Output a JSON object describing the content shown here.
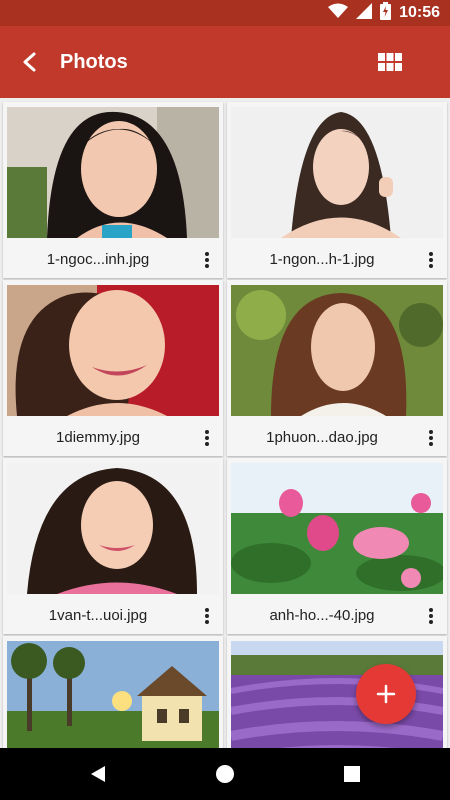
{
  "status_bar": {
    "time": "10:56",
    "icons": [
      "wifi-icon",
      "signal-icon",
      "battery-charging-icon"
    ]
  },
  "app_bar": {
    "title": "Photos",
    "back_icon": "chevron-left-icon",
    "view_icon": "grid-view-icon",
    "background": "#c0392b"
  },
  "photos": [
    {
      "file_name": "1-ngoc...inh.jpg",
      "thumbnail": "portrait"
    },
    {
      "file_name": "1-ngon...h-1.jpg",
      "thumbnail": "portrait"
    },
    {
      "file_name": "1diemmy.jpg",
      "thumbnail": "portrait"
    },
    {
      "file_name": "1phuon...dao.jpg",
      "thumbnail": "portrait"
    },
    {
      "file_name": "1van-t...uoi.jpg",
      "thumbnail": "portrait"
    },
    {
      "file_name": "anh-ho...-40.jpg",
      "thumbnail": "lotus"
    },
    {
      "file_name": "",
      "thumbnail": "house"
    },
    {
      "file_name": "",
      "thumbnail": "lavender"
    }
  ],
  "fab": {
    "icon": "plus-icon",
    "color": "#e53935"
  },
  "nav_bar": {
    "icons": [
      "back-triangle-icon",
      "home-circle-icon",
      "recents-square-icon"
    ]
  }
}
